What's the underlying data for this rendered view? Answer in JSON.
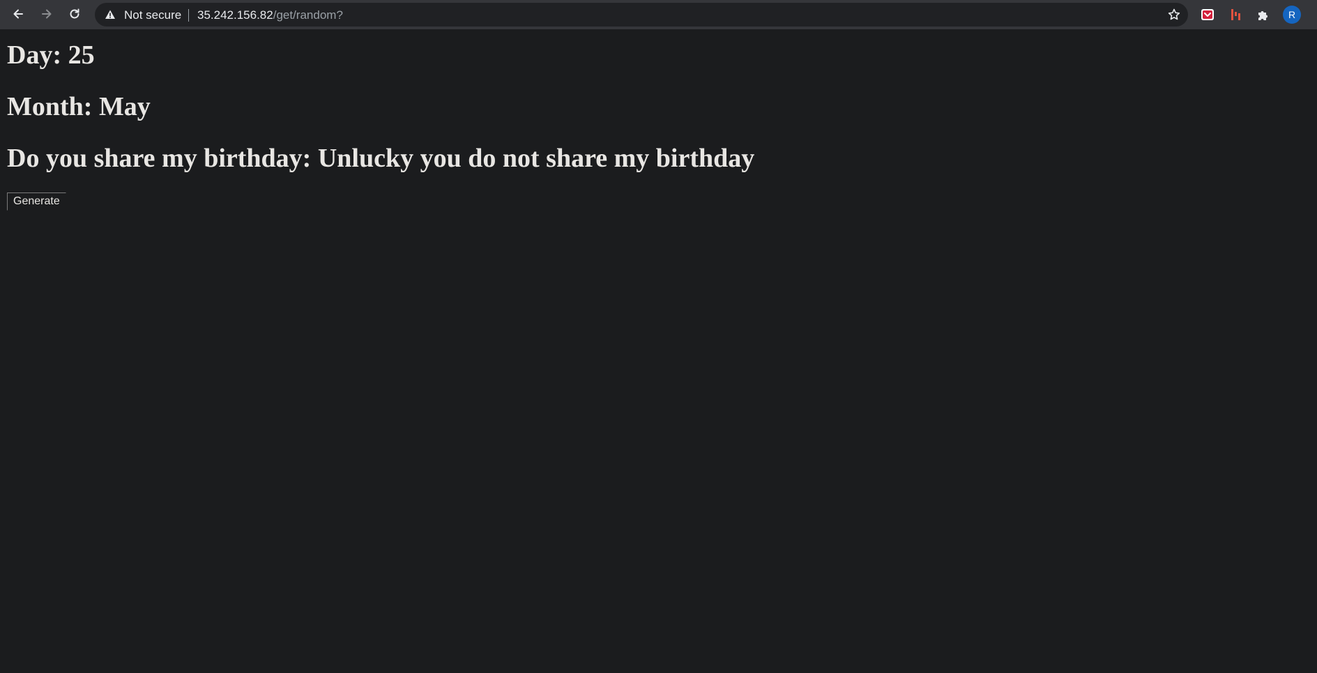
{
  "browser": {
    "security_label": "Not secure",
    "url_host": "35.242.156.82",
    "url_path": "/get/random?",
    "profile_initial": "R",
    "icons": {
      "back": "back-arrow-icon",
      "forward": "forward-arrow-icon",
      "reload": "reload-icon",
      "warning": "warning-triangle-icon",
      "bookmark": "star-icon",
      "ext1": "pocket-icon",
      "ext2": "extension-bars-icon",
      "extensions": "puzzle-icon"
    },
    "colors": {
      "toolbar": "#35363a",
      "omnibox": "#202124",
      "avatar": "#1565c0",
      "ext_red": "#e0533f"
    }
  },
  "page": {
    "day_line": "Day: 25",
    "month_line": "Month: May",
    "share_line": "Do you share my birthday: Unlucky you do not share my birthday",
    "generate_label": "Generate",
    "colors": {
      "background": "#1b1c1e",
      "text": "#e8e6e3"
    }
  }
}
